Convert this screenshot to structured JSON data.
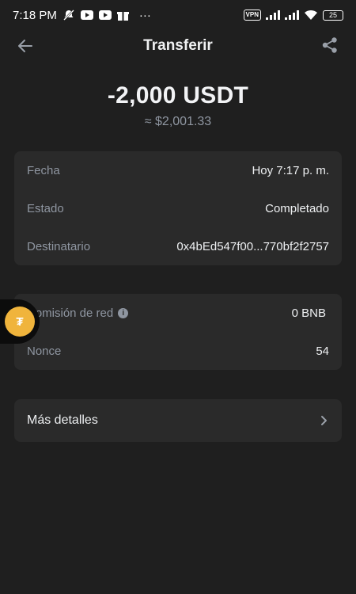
{
  "status_bar": {
    "time": "7:18 PM",
    "more": "···",
    "vpn": "VPN",
    "battery": "25"
  },
  "header": {
    "title": "Transferir"
  },
  "summary": {
    "amount": "-2,000 USDT",
    "fiat": "≈ $2,001.33"
  },
  "details": [
    {
      "label": "Fecha",
      "value": "Hoy 7:17 p. m."
    },
    {
      "label": "Estado",
      "value": "Completado"
    },
    {
      "label": "Destinatario",
      "value": "0x4bEd547f00...770bf2f2757"
    }
  ],
  "fees": [
    {
      "label": "Comisión de red",
      "value": "0 BNB",
      "has_info": true
    },
    {
      "label": "Nonce",
      "value": "54"
    }
  ],
  "more": {
    "label": "Más detalles"
  },
  "floating": {
    "coin_glyph": "₮"
  },
  "colors": {
    "background": "#1f1f1f",
    "card": "#2a2a2a",
    "muted": "#8f96a1",
    "coin": "#f0b43c"
  }
}
